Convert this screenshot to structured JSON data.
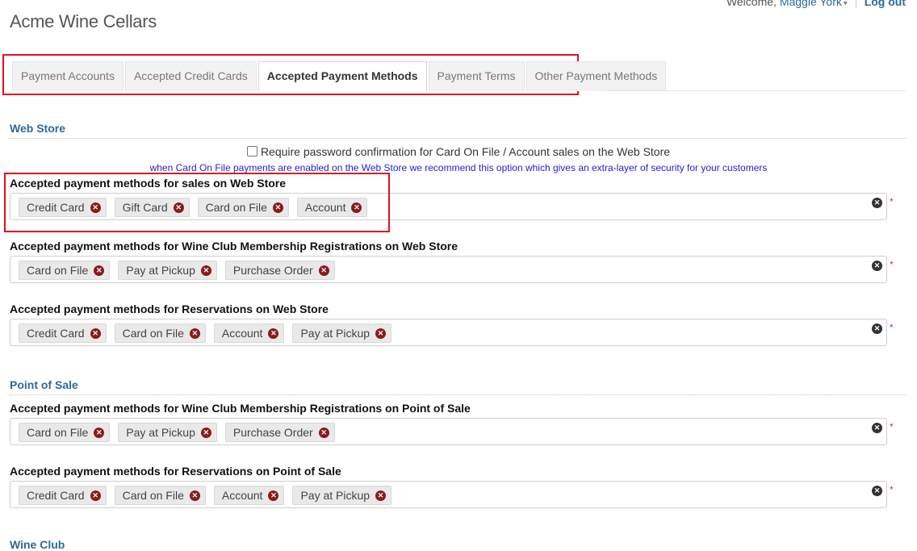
{
  "header": {
    "welcome_text": "Welcome,",
    "user_name": "Maggie York",
    "logout_label": "Log out"
  },
  "app_title": "Acme Wine Cellars",
  "tabs": [
    {
      "label": "Payment Accounts",
      "active": false
    },
    {
      "label": "Accepted Credit Cards",
      "active": false
    },
    {
      "label": "Accepted Payment Methods",
      "active": true
    },
    {
      "label": "Payment Terms",
      "active": false
    },
    {
      "label": "Other Payment Methods",
      "active": false
    }
  ],
  "web_store": {
    "title": "Web Store",
    "password_option": {
      "checked": false,
      "label": "Require password confirmation for Card On File / Account sales on the Web Store",
      "note": "when Card On File payments are enabled on the Web Store we recommend this option which gives an extra-layer of security for your customers"
    },
    "fields": [
      {
        "label": "Accepted payment methods for sales on Web Store",
        "tags": [
          "Credit Card",
          "Gift Card",
          "Card on File",
          "Account"
        ]
      },
      {
        "label": "Accepted payment methods for Wine Club Membership Registrations on Web Store",
        "tags": [
          "Card on File",
          "Pay at Pickup",
          "Purchase Order"
        ]
      },
      {
        "label": "Accepted payment methods for Reservations on Web Store",
        "tags": [
          "Credit Card",
          "Card on File",
          "Account",
          "Pay at Pickup"
        ]
      }
    ]
  },
  "point_of_sale": {
    "title": "Point of Sale",
    "fields": [
      {
        "label": "Accepted payment methods for Wine Club Membership Registrations on Point of Sale",
        "tags": [
          "Card on File",
          "Pay at Pickup",
          "Purchase Order"
        ]
      },
      {
        "label": "Accepted payment methods for Reservations on Point of Sale",
        "tags": [
          "Credit Card",
          "Card on File",
          "Account",
          "Pay at Pickup"
        ]
      }
    ]
  },
  "wine_club": {
    "title": "Wine Club"
  },
  "icons": {
    "remove_tag": "remove-circle-icon",
    "clear_all": "clear-all-icon"
  },
  "colors": {
    "accent": "#2c6a9a",
    "highlight": "#e0111b",
    "remove": "#8b1a1a",
    "required": "#d9362b"
  },
  "required_marker": "*"
}
